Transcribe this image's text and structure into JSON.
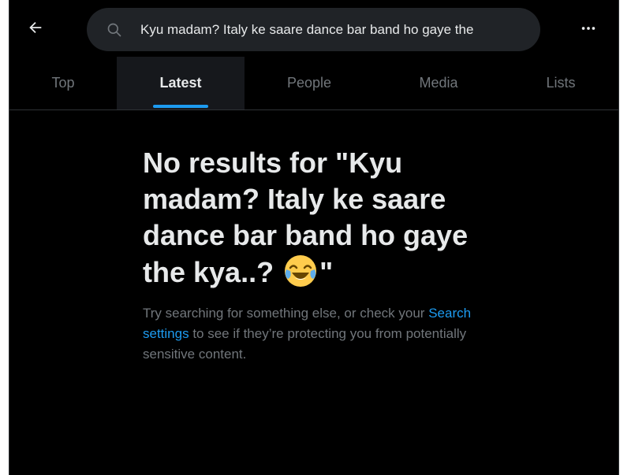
{
  "topbar": {
    "back_icon": "arrow-left-icon",
    "search": {
      "icon": "search-icon",
      "value": "Kyu madam? Italy ke saare dance bar band ho gaye the"
    },
    "more_icon": "more-horizontal-icon"
  },
  "tabs": [
    {
      "label": "Top",
      "active": false
    },
    {
      "label": "Latest",
      "active": true
    },
    {
      "label": "People",
      "active": false
    },
    {
      "label": "Media",
      "active": false
    },
    {
      "label": "Lists",
      "active": false
    }
  ],
  "empty_state": {
    "title_prefix": "No results for \"Kyu madam? Italy ke saare dance bar band ho gaye the kya..?",
    "title_emoji": "face-with-tears-of-joy",
    "title_suffix": "\"",
    "subtitle_before": "Try searching for something else, or check your",
    "subtitle_link": "Search settings",
    "subtitle_after": "to see if they’re protecting you from potentially sensitive content."
  },
  "colors": {
    "background": "#000000",
    "search_bg": "#202327",
    "text_primary": "#e7e9ea",
    "text_secondary": "#71767b",
    "accent": "#1d9bf0",
    "divider": "#2f3336"
  }
}
